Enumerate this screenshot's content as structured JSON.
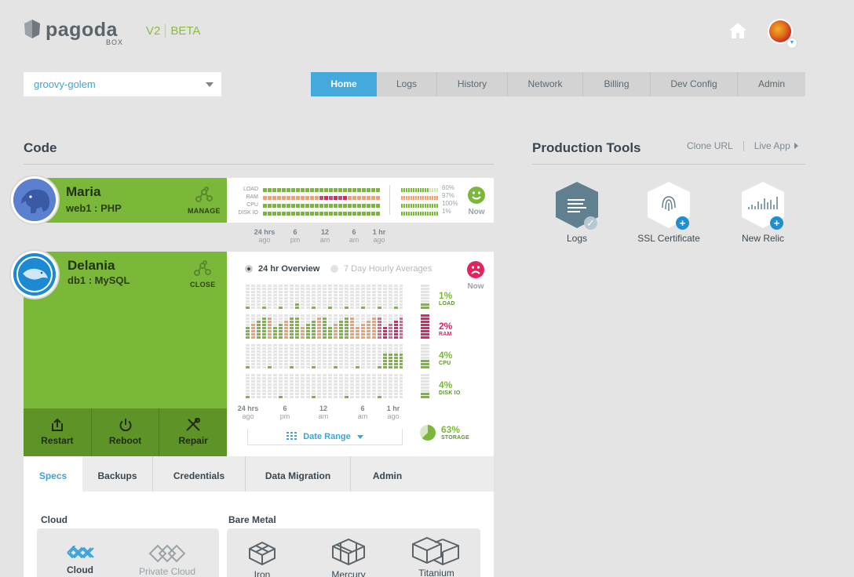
{
  "header": {
    "brand": "pagoda",
    "brand_sub": "BOX",
    "version": "V2",
    "beta": "BETA"
  },
  "app_selector": {
    "value": "groovy-golem"
  },
  "nav": {
    "tabs": [
      "Home",
      "Logs",
      "History",
      "Network",
      "Billing",
      "Dev Config",
      "Admin"
    ],
    "active": "Home"
  },
  "code": {
    "title": "Code",
    "components": [
      {
        "name": "Maria",
        "sub": "web1 : PHP",
        "action": "MANAGE",
        "metric_labels": [
          "LOAD",
          "RAM",
          "CPU",
          "DISK IO"
        ],
        "metric_values": [
          "60%",
          "97%",
          "100%",
          "1%"
        ],
        "status": "Now",
        "status_mood": "happy",
        "time_axis": [
          {
            "top": "24 hrs",
            "bottom": "ago"
          },
          {
            "top": "6",
            "bottom": "pm"
          },
          {
            "top": "12",
            "bottom": "am"
          },
          {
            "top": "6",
            "bottom": "am"
          },
          {
            "top": "1 hr",
            "bottom": "ago"
          }
        ]
      },
      {
        "name": "Delania",
        "sub": "db1 : MySQL",
        "action": "CLOSE",
        "status": "Now",
        "status_mood": "sad",
        "views": [
          "24 hr Overview",
          "7 Day Hourly Averages"
        ],
        "active_view": "24 hr Overview",
        "metrics": [
          {
            "value": "1%",
            "label": "LOAD",
            "color": "#7bb83a"
          },
          {
            "value": "2%",
            "label": "RAM",
            "color": "#e0245e"
          },
          {
            "value": "4%",
            "label": "CPU",
            "color": "#7bb83a"
          },
          {
            "value": "4%",
            "label": "DISK IO",
            "color": "#7bb83a"
          }
        ],
        "storage": {
          "value": "63%",
          "label": "STORAGE",
          "fraction": 0.63
        },
        "date_range": "Date Range",
        "time_axis": [
          {
            "top": "24 hrs",
            "bottom": "ago"
          },
          {
            "top": "6",
            "bottom": "pm"
          },
          {
            "top": "12",
            "bottom": "am"
          },
          {
            "top": "6",
            "bottom": "am"
          },
          {
            "top": "1 hr",
            "bottom": "ago"
          }
        ],
        "actions": [
          "Restart",
          "Reboot",
          "Repair"
        ]
      }
    ]
  },
  "production": {
    "title": "Production Tools",
    "links": [
      "Clone URL",
      "Live App"
    ],
    "tools": [
      {
        "label": "Logs",
        "installed": true
      },
      {
        "label": "SSL Certificate",
        "installed": false
      },
      {
        "label": "New Relic",
        "installed": false
      }
    ]
  },
  "lower_tabs": {
    "tabs": [
      "Specs",
      "Backups",
      "Credentials",
      "Data Migration",
      "Admin"
    ],
    "active": "Specs"
  },
  "specs": {
    "cloud_title": "Cloud",
    "metal_title": "Bare Metal",
    "cloud_options": [
      "Cloud",
      "Private Cloud"
    ],
    "metal_options": [
      "Iron",
      "Mercury",
      "Titanium"
    ],
    "selected": "Cloud"
  },
  "colors": {
    "green": "#7bb83a",
    "dark_green": "#5e9328",
    "blue": "#46a9dc",
    "red": "#e0245e",
    "orange": "#f0a070"
  }
}
